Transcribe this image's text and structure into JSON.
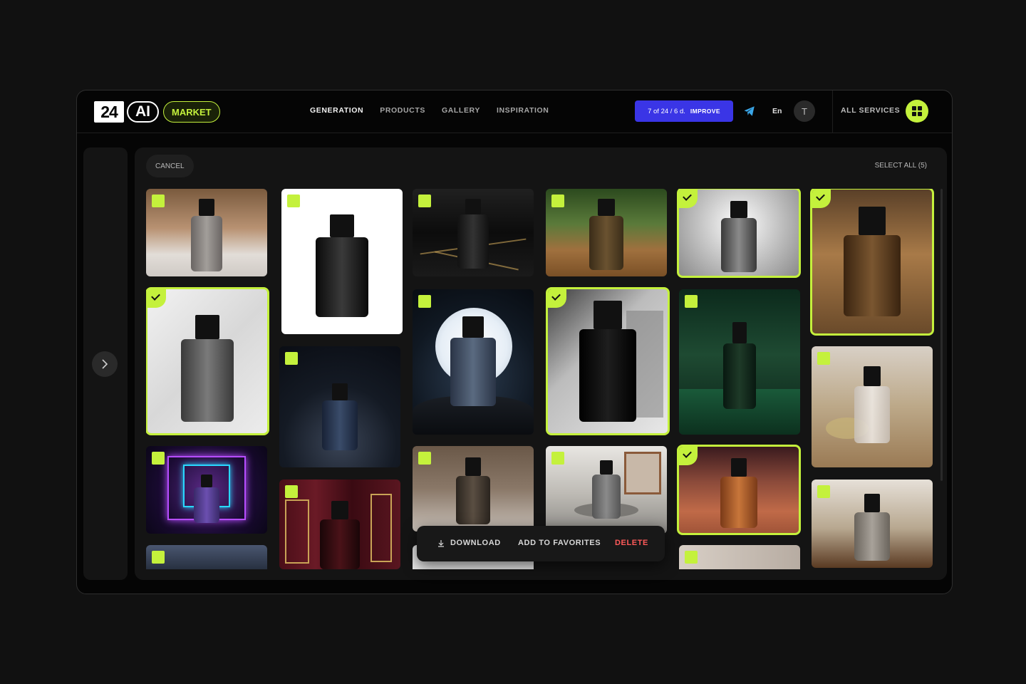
{
  "header": {
    "logo": {
      "part1": "24",
      "part2": "AI",
      "badge": "MARKET"
    },
    "nav": [
      {
        "label": "GENERATION",
        "active": true
      },
      {
        "label": "PRODUCTS",
        "active": false
      },
      {
        "label": "GALLERY",
        "active": false
      },
      {
        "label": "INSPIRATION",
        "active": false
      }
    ],
    "quota": {
      "text": "7  of 24 / 6 d.",
      "action": "IMPROVE"
    },
    "telegram_icon": "telegram-icon",
    "language": "En",
    "avatar_initial": "T",
    "all_services": "ALL SERVICES",
    "grid_icon": "grid-icon"
  },
  "toolbar": {
    "cancel": "CANCEL",
    "select_all": "SELECT ALL (5)"
  },
  "selection_count": 5,
  "action_bar": {
    "download": "DOWNLOAD",
    "favorites": "ADD TO FAVORITES",
    "delete": "DELETE"
  },
  "colors": {
    "accent": "#c4f13c",
    "quota_bg": "#3a35e6",
    "delete": "#ff5a5a",
    "background": "#111111"
  },
  "gallery": [
    {
      "name": "marble-counter-interior",
      "selected": false
    },
    {
      "name": "black-bottle-white-bg",
      "selected": false
    },
    {
      "name": "black-marble-gold-veins",
      "selected": false
    },
    {
      "name": "wood-table-greenery",
      "selected": false
    },
    {
      "name": "moon-backdrop-gray",
      "selected": true
    },
    {
      "name": "amber-bottle-studio",
      "selected": true
    },
    {
      "name": "white-marble-wall",
      "selected": true
    },
    {
      "name": "dark-bokeh-stage",
      "selected": false
    },
    {
      "name": "moon-night-rock",
      "selected": false
    },
    {
      "name": "black-bottle-shadow",
      "selected": true
    },
    {
      "name": "green-velvet-drape",
      "selected": false
    },
    {
      "name": "lavender-wood-table",
      "selected": false
    },
    {
      "name": "neon-tunnel",
      "selected": false
    },
    {
      "name": "red-curtain-gold",
      "selected": false
    },
    {
      "name": "bokeh-window-plant",
      "selected": false
    },
    {
      "name": "zen-stones-window",
      "selected": false
    },
    {
      "name": "city-bokeh-amber",
      "selected": true
    },
    {
      "name": "book-wood-warm",
      "selected": false
    },
    {
      "name": "partial-blue-dusk",
      "selected": false
    },
    {
      "name": "partial-white-window",
      "selected": false
    },
    {
      "name": "partial-dark-stone",
      "selected": false
    },
    {
      "name": "partial-cafe-window",
      "selected": false
    }
  ]
}
